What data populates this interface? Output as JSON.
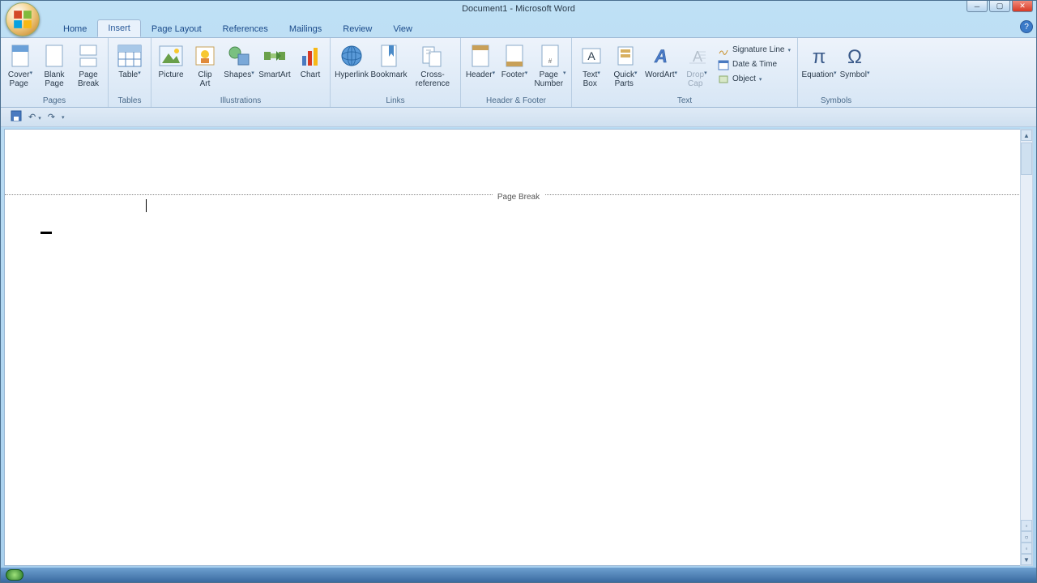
{
  "window": {
    "title": "Document1 - Microsoft Word"
  },
  "tabs": {
    "home": "Home",
    "insert": "Insert",
    "page_layout": "Page Layout",
    "references": "References",
    "mailings": "Mailings",
    "review": "Review",
    "view": "View"
  },
  "groups": {
    "pages": "Pages",
    "tables": "Tables",
    "illustrations": "Illustrations",
    "links": "Links",
    "header_footer": "Header & Footer",
    "text": "Text",
    "symbols": "Symbols"
  },
  "buttons": {
    "cover_page": "Cover\nPage",
    "blank_page": "Blank\nPage",
    "page_break": "Page\nBreak",
    "table": "Table",
    "picture": "Picture",
    "clip_art": "Clip\nArt",
    "shapes": "Shapes",
    "smartart": "SmartArt",
    "chart": "Chart",
    "hyperlink": "Hyperlink",
    "bookmark": "Bookmark",
    "cross_reference": "Cross-reference",
    "header": "Header",
    "footer": "Footer",
    "page_number": "Page\nNumber",
    "text_box": "Text\nBox",
    "quick_parts": "Quick\nParts",
    "wordart": "WordArt",
    "drop_cap": "Drop\nCap",
    "signature_line": "Signature Line",
    "date_time": "Date & Time",
    "object": "Object",
    "equation": "Equation",
    "symbol": "Symbol"
  },
  "document": {
    "page_break_label": "Page Break"
  }
}
